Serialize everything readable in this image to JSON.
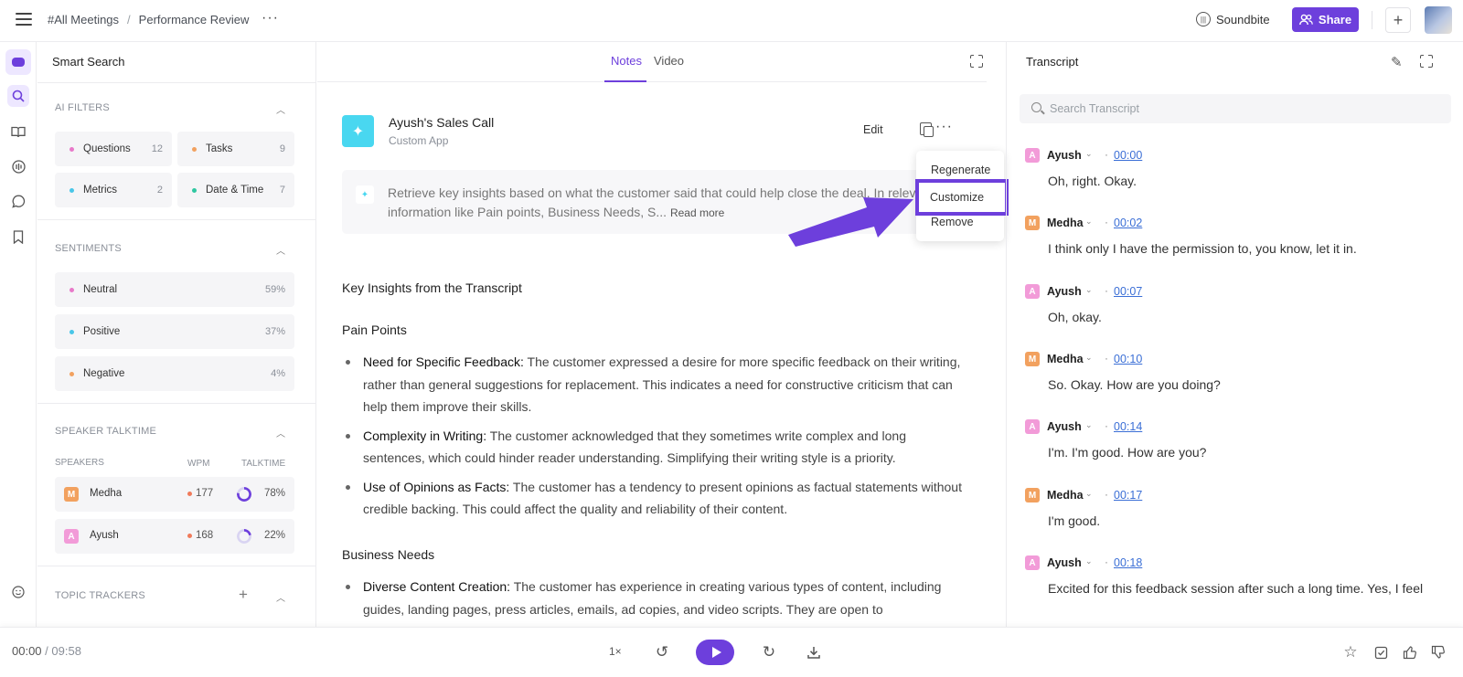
{
  "breadcrumb": {
    "root": "#All Meetings",
    "separator": "/",
    "current": "Performance Review",
    "more": "···"
  },
  "header": {
    "soundbite_label": "Soundbite",
    "share_label": "Share",
    "plus": "+"
  },
  "smart_search": {
    "title": "Smart Search",
    "ai_filters": {
      "label": "AI FILTERS",
      "items": [
        {
          "label": "Questions",
          "count": "12",
          "color": "#e879c9"
        },
        {
          "label": "Tasks",
          "count": "9",
          "color": "#f2a15f"
        },
        {
          "label": "Metrics",
          "count": "2",
          "color": "#49c6e8"
        },
        {
          "label": "Date & Time",
          "count": "7",
          "color": "#2fc7a1"
        }
      ]
    },
    "sentiments": {
      "label": "SENTIMENTS",
      "items": [
        {
          "label": "Neutral",
          "pct": "59%",
          "color": "#e879c9"
        },
        {
          "label": "Positive",
          "pct": "37%",
          "color": "#49c6e8"
        },
        {
          "label": "Negative",
          "pct": "4%",
          "color": "#f2a15f"
        }
      ]
    },
    "talktime": {
      "label": "SPEAKER TALKTIME",
      "col_speakers": "SPEAKERS",
      "col_wpm": "WPM",
      "col_talktime": "TALKTIME",
      "rows": [
        {
          "initial": "M",
          "name": "Medha",
          "wpm": "177",
          "pct": "78%",
          "share": 0.78,
          "color": "#f2a15f"
        },
        {
          "initial": "A",
          "name": "Ayush",
          "wpm": "168",
          "pct": "22%",
          "share": 0.22,
          "color": "#f29bd8"
        }
      ]
    },
    "topic_trackers": {
      "label": "TOPIC TRACKERS"
    }
  },
  "notes": {
    "tabs": [
      "Notes",
      "Video"
    ],
    "app_title": "Ayush's Sales Call",
    "app_subtitle": "Custom App",
    "edit_label": "Edit",
    "prompt_text": "Retrieve key insights based on what the customer said that could help close the deal. In relevant information like Pain points, Business Needs, S...",
    "read_more": "Read more",
    "heading": "Key Insights from the Transcript",
    "sections": [
      {
        "title": "Pain Points",
        "bullets": [
          {
            "lead": "Need for Specific Feedback:",
            "text": " The customer expressed a desire for more specific feedback on their writing, rather than general suggestions for replacement. This indicates a need for constructive criticism that can help them improve their skills."
          },
          {
            "lead": "Complexity in Writing:",
            "text": " The customer acknowledged that they sometimes write complex and long sentences, which could hinder reader understanding. Simplifying their writing style is a priority."
          },
          {
            "lead": "Use of Opinions as Facts:",
            "text": " The customer has a tendency to present opinions as factual statements without credible backing. This could affect the quality and reliability of their content."
          }
        ]
      },
      {
        "title": "Business Needs",
        "bullets": [
          {
            "lead": "Diverse Content Creation:",
            "text": " The customer has experience in creating various types of content, including guides, landing pages, press articles, emails, ad copies, and video scripts. They are open to"
          }
        ]
      }
    ]
  },
  "menu": {
    "items": [
      "Regenerate",
      "Customize",
      "Remove"
    ]
  },
  "transcript": {
    "title": "Transcript",
    "search_placeholder": "Search Transcript",
    "utterances": [
      {
        "initial": "A",
        "speaker": "Ayush",
        "time": "00:00",
        "text": "Oh, right. Okay.",
        "color": "#f29bd8"
      },
      {
        "initial": "M",
        "speaker": "Medha",
        "time": "00:02",
        "text": "I think only I have the permission to, you know, let it in.",
        "color": "#f2a15f"
      },
      {
        "initial": "A",
        "speaker": "Ayush",
        "time": "00:07",
        "text": "Oh, okay.",
        "color": "#f29bd8"
      },
      {
        "initial": "M",
        "speaker": "Medha",
        "time": "00:10",
        "text": "So. Okay. How are you doing?",
        "color": "#f2a15f"
      },
      {
        "initial": "A",
        "speaker": "Ayush",
        "time": "00:14",
        "text": "I'm. I'm good. How are you?",
        "color": "#f29bd8"
      },
      {
        "initial": "M",
        "speaker": "Medha",
        "time": "00:17",
        "text": "I'm good.",
        "color": "#f2a15f"
      },
      {
        "initial": "A",
        "speaker": "Ayush",
        "time": "00:18",
        "text": "Excited for this feedback session after such a long time. Yes, I feel",
        "color": "#f29bd8"
      }
    ]
  },
  "player": {
    "current": "00:00",
    "separator": "/",
    "duration": "09:58",
    "speed": "1×"
  },
  "colors": {
    "accent": "#6d3fdc",
    "link": "#3b6fd6",
    "app_icon": "#49d7f0"
  }
}
